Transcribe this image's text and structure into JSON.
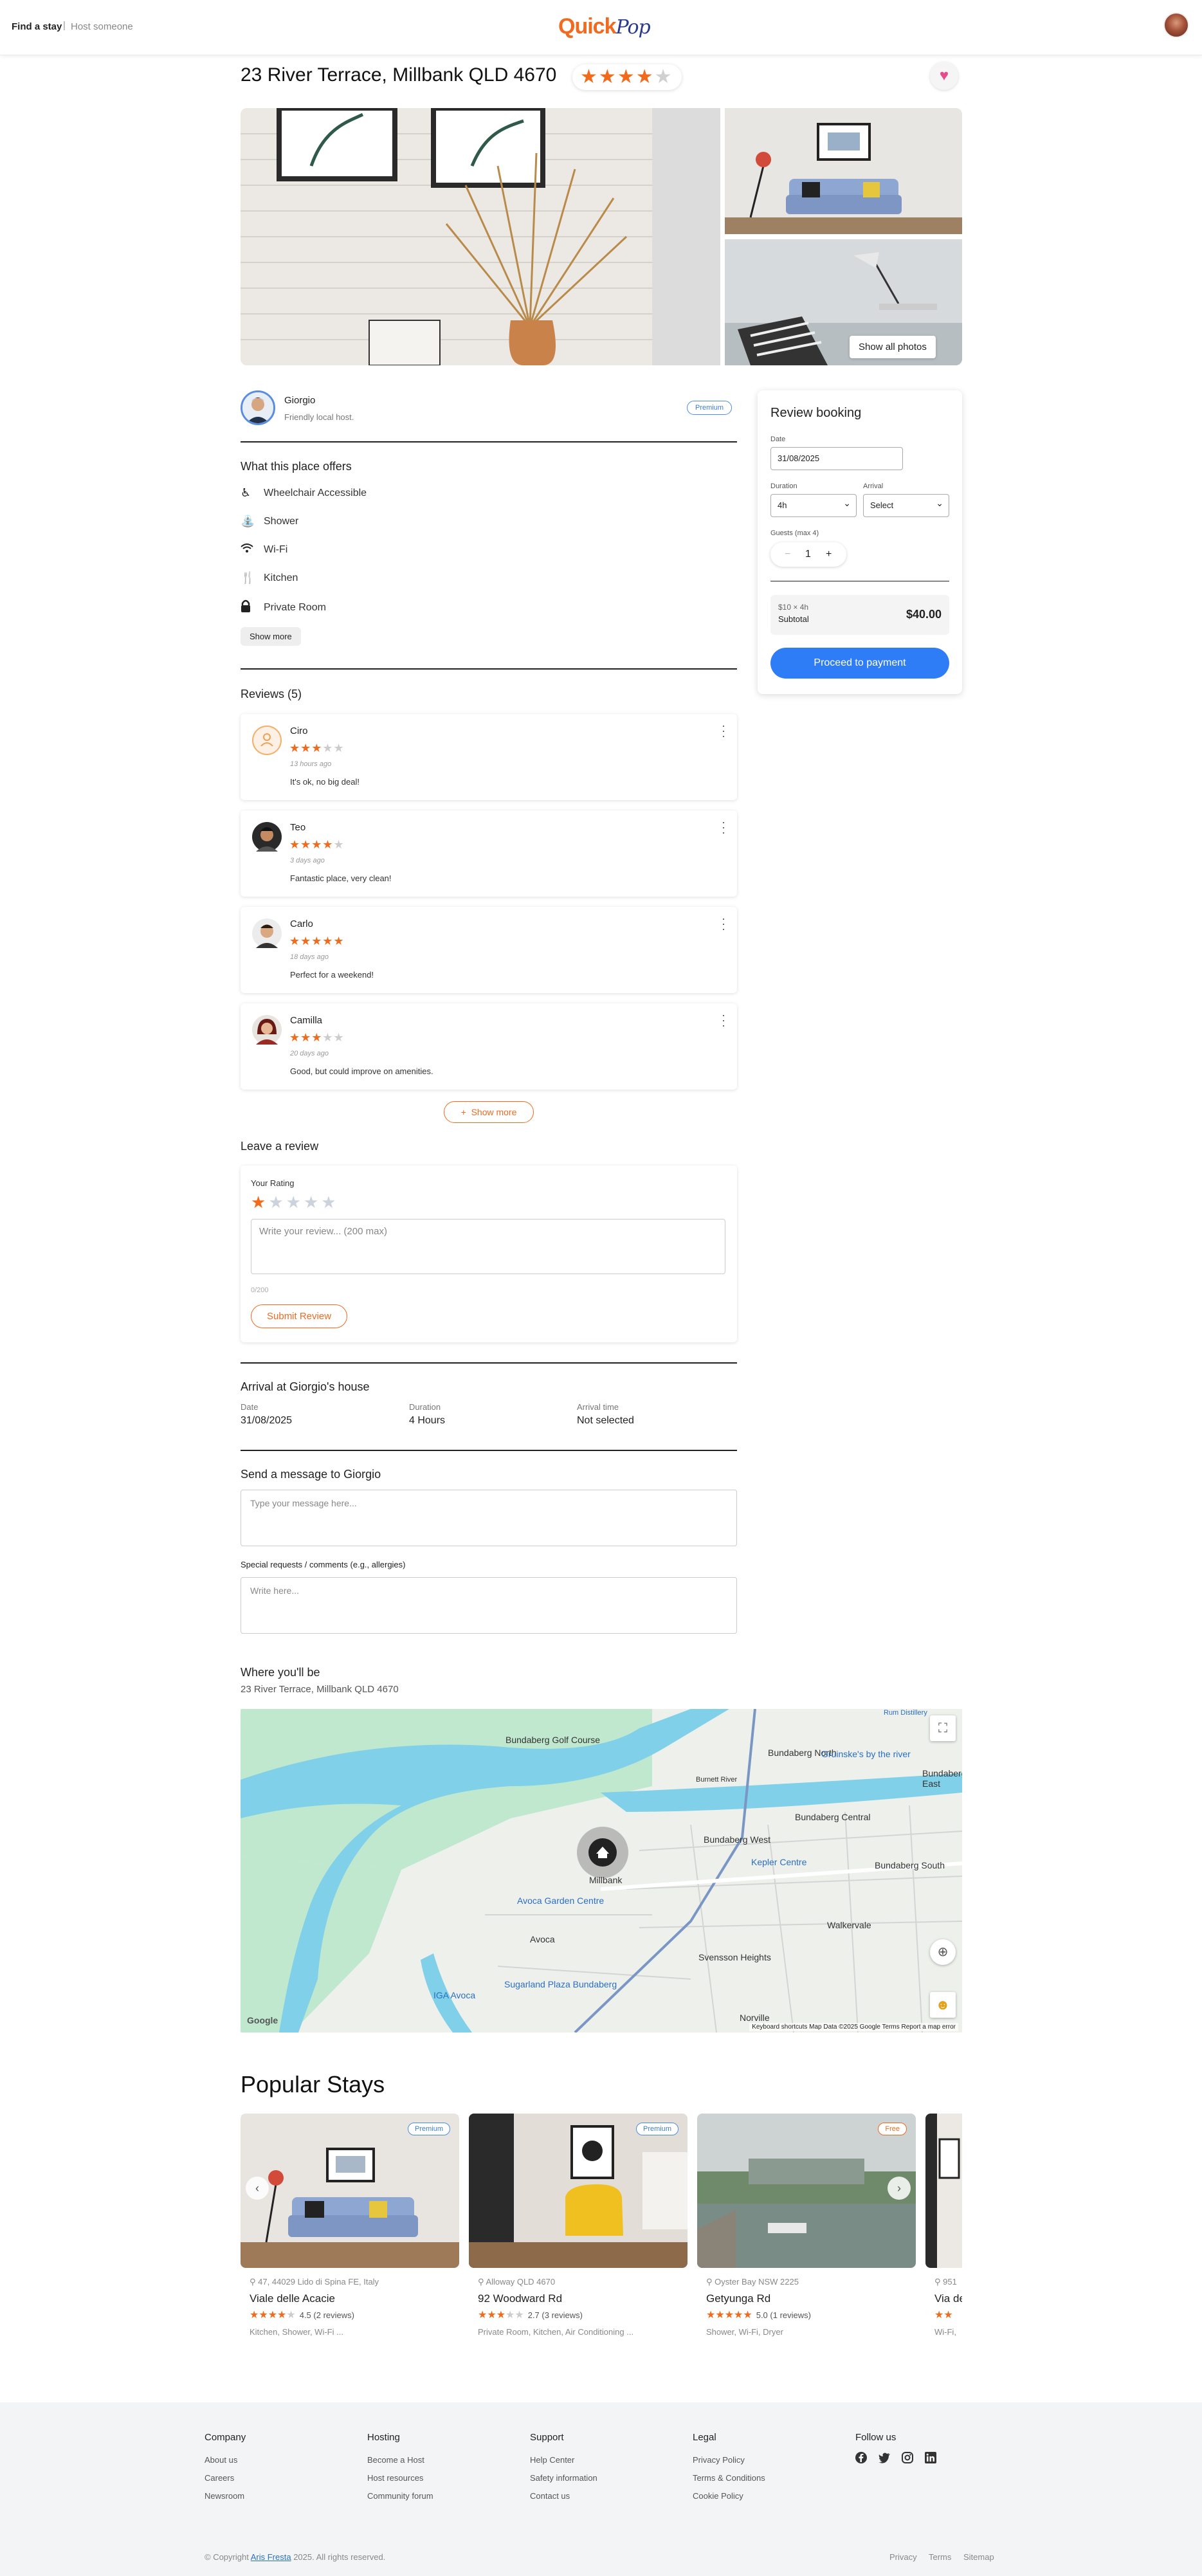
{
  "header": {
    "find_stay": "Find a stay",
    "separator": "|",
    "host_someone": "Host someone",
    "logo_main": "Quick",
    "logo_script": "Pop"
  },
  "listing": {
    "title": "23 River Terrace, Millbank QLD 4670",
    "rating_stars": 4,
    "show_all_photos": "Show all photos",
    "host_name": "Giorgio",
    "host_tagline": "Friendly local host.",
    "host_badge": "Premium"
  },
  "amenities": {
    "title": "What this place offers",
    "items": [
      {
        "label": "Wheelchair Accessible",
        "icon": "wheelchair-icon"
      },
      {
        "label": "Shower",
        "icon": "shower-icon"
      },
      {
        "label": "Wi-Fi",
        "icon": "wifi-icon"
      },
      {
        "label": "Kitchen",
        "icon": "kitchen-icon"
      },
      {
        "label": "Private Room",
        "icon": "lock-icon"
      }
    ],
    "show_more": "Show more"
  },
  "reviews": {
    "title": "Reviews (5)",
    "items": [
      {
        "name": "Ciro",
        "stars": 3,
        "time": "13 hours ago",
        "text": "It's ok, no big deal!"
      },
      {
        "name": "Teo",
        "stars": 4,
        "time": "3 days ago",
        "text": "Fantastic place, very clean!"
      },
      {
        "name": "Carlo",
        "stars": 5,
        "time": "18 days ago",
        "text": "Perfect for a weekend!"
      },
      {
        "name": "Camilla",
        "stars": 3,
        "time": "20 days ago",
        "text": "Good, but could improve on amenities."
      }
    ],
    "show_more": "Show more"
  },
  "leave_review": {
    "title": "Leave a review",
    "rating_label": "Your Rating",
    "rating_value": 1,
    "placeholder": "Write your review... (200 max)",
    "counter": "0/200",
    "submit": "Submit Review"
  },
  "arrival": {
    "title": "Arrival at Giorgio's house",
    "date_label": "Date",
    "date_value": "31/08/2025",
    "duration_label": "Duration",
    "duration_value": "4 Hours",
    "time_label": "Arrival time",
    "time_value": "Not selected"
  },
  "message": {
    "title": "Send a message to Giorgio",
    "placeholder": "Type your message here...",
    "special_label": "Special requests / comments (e.g., allergies)",
    "special_placeholder": "Write here..."
  },
  "location": {
    "title": "Where you'll be",
    "address": "23 River Terrace, Millbank QLD 4670",
    "map_labels": [
      "Bundaberg Golf Course",
      "Bundaberg North",
      "Gruinske's by the river",
      "Bundaberg East",
      "Bundaberg West",
      "Bundaberg Central",
      "Bundaberg South",
      "Kepler Centre",
      "Millbank",
      "Avoca Garden Centre",
      "Avoca",
      "Walkervale",
      "Svensson Heights",
      "Sugarland Plaza Bundaberg",
      "IGA Avoca",
      "Norville",
      "Burnett River",
      "Rum Distillery"
    ],
    "map_footer": "Keyboard shortcuts   Map Data ©2025 Google   Terms   Report a map error",
    "google": "Google"
  },
  "booking": {
    "title": "Review booking",
    "date_label": "Date",
    "date_value": "31/08/2025",
    "duration_label": "Duration",
    "duration_value": "4h",
    "arrival_label": "Arrival",
    "arrival_value": "Select",
    "guests_label": "Guests (max 4)",
    "guests_value": "1",
    "minus": "−",
    "plus": "+",
    "price_line": "$10 × 4h",
    "subtotal_label": "Subtotal",
    "subtotal_value": "$40.00",
    "proceed": "Proceed to payment"
  },
  "popular": {
    "title": "Popular Stays",
    "cards": [
      {
        "badge": "Premium",
        "location": "47, 44029 Lido di Spina FE, Italy",
        "name": "Viale delle Acacie",
        "stars": 4.5,
        "rating": "4.5 (2 reviews)",
        "amenities": "Kitchen, Shower, Wi-Fi ..."
      },
      {
        "badge": "Premium",
        "location": "Alloway QLD 4670",
        "name": "92 Woodward Rd",
        "stars": 2.7,
        "rating": "2.7 (3 reviews)",
        "amenities": "Private Room, Kitchen, Air Conditioning ..."
      },
      {
        "badge": "Free",
        "location": "Oyster Bay NSW 2225",
        "name": "Getyunga Rd",
        "stars": 5.0,
        "rating": "5.0 (1 reviews)",
        "amenities": "Shower, Wi-Fi, Dryer"
      },
      {
        "badge": "",
        "location": "951",
        "name": "Via de",
        "stars": 1,
        "rating": "",
        "amenities": "Wi-Fi,"
      }
    ]
  },
  "footer": {
    "columns": [
      {
        "title": "Company",
        "links": [
          "About us",
          "Careers",
          "Newsroom"
        ]
      },
      {
        "title": "Hosting",
        "links": [
          "Become a Host",
          "Host resources",
          "Community forum"
        ]
      },
      {
        "title": "Support",
        "links": [
          "Help Center",
          "Safety information",
          "Contact us"
        ]
      },
      {
        "title": "Legal",
        "links": [
          "Privacy Policy",
          "Terms & Conditions",
          "Cookie Policy"
        ]
      },
      {
        "title": "Follow us",
        "links": []
      }
    ],
    "copy_prefix": "© Copyright",
    "copy_name": "Aris Fresta",
    "copy_suffix": "2025. All rights reserved.",
    "bottom_links": [
      "Privacy",
      "Terms",
      "Sitemap"
    ]
  },
  "colors": {
    "accent": "#f06a1f",
    "brand_blue": "#2e7cf6",
    "star": "#f26b1d",
    "fav": "#e84a8e"
  }
}
